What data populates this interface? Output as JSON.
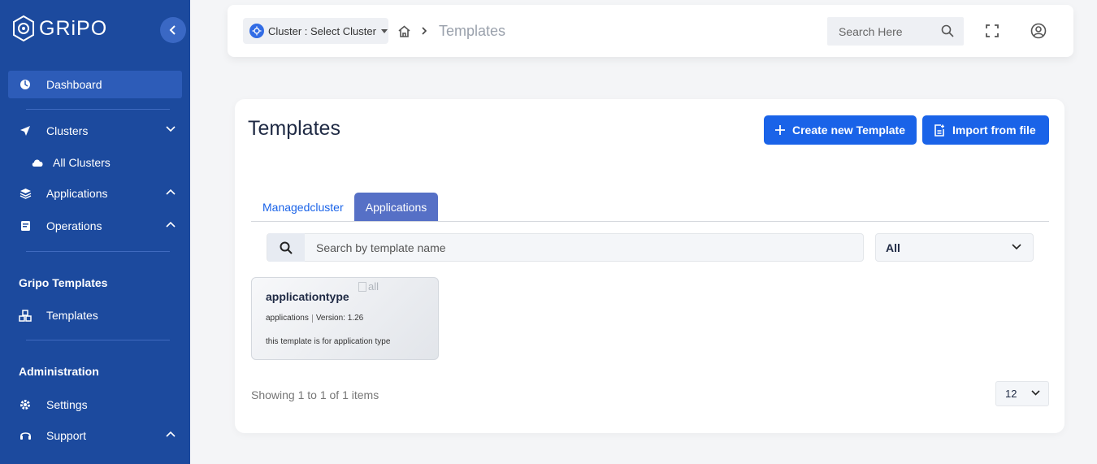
{
  "brand": {
    "name": "GRiPO"
  },
  "sidebar": {
    "dashboard": "Dashboard",
    "clusters": "Clusters",
    "all_clusters": "All Clusters",
    "applications": "Applications",
    "operations": "Operations",
    "section_templates": "Gripo Templates",
    "templates": "Templates",
    "section_admin": "Administration",
    "settings": "Settings",
    "support": "Support"
  },
  "header": {
    "cluster_select": "Cluster : Select Cluster",
    "breadcrumb_current": "Templates",
    "search_placeholder": "Search Here"
  },
  "main": {
    "title": "Templates",
    "create_button": "Create new Template",
    "import_button": "Import from file",
    "tabs": [
      "Managedcluster",
      "Applications"
    ],
    "active_tab": "Applications",
    "template_search_placeholder": "Search by template name",
    "filter_value": "All",
    "templates": [
      {
        "name": "applicationtype",
        "image_alt": "all",
        "category": "applications",
        "version": "Version: 1.26",
        "description": "this template is for application type"
      }
    ],
    "showing": "Showing 1 to 1 of 1 items",
    "page_size": "12"
  },
  "colors": {
    "sidebar_bg": "#1c4a9e",
    "primary": "#1a63e8",
    "active_tab": "#5670c6"
  }
}
